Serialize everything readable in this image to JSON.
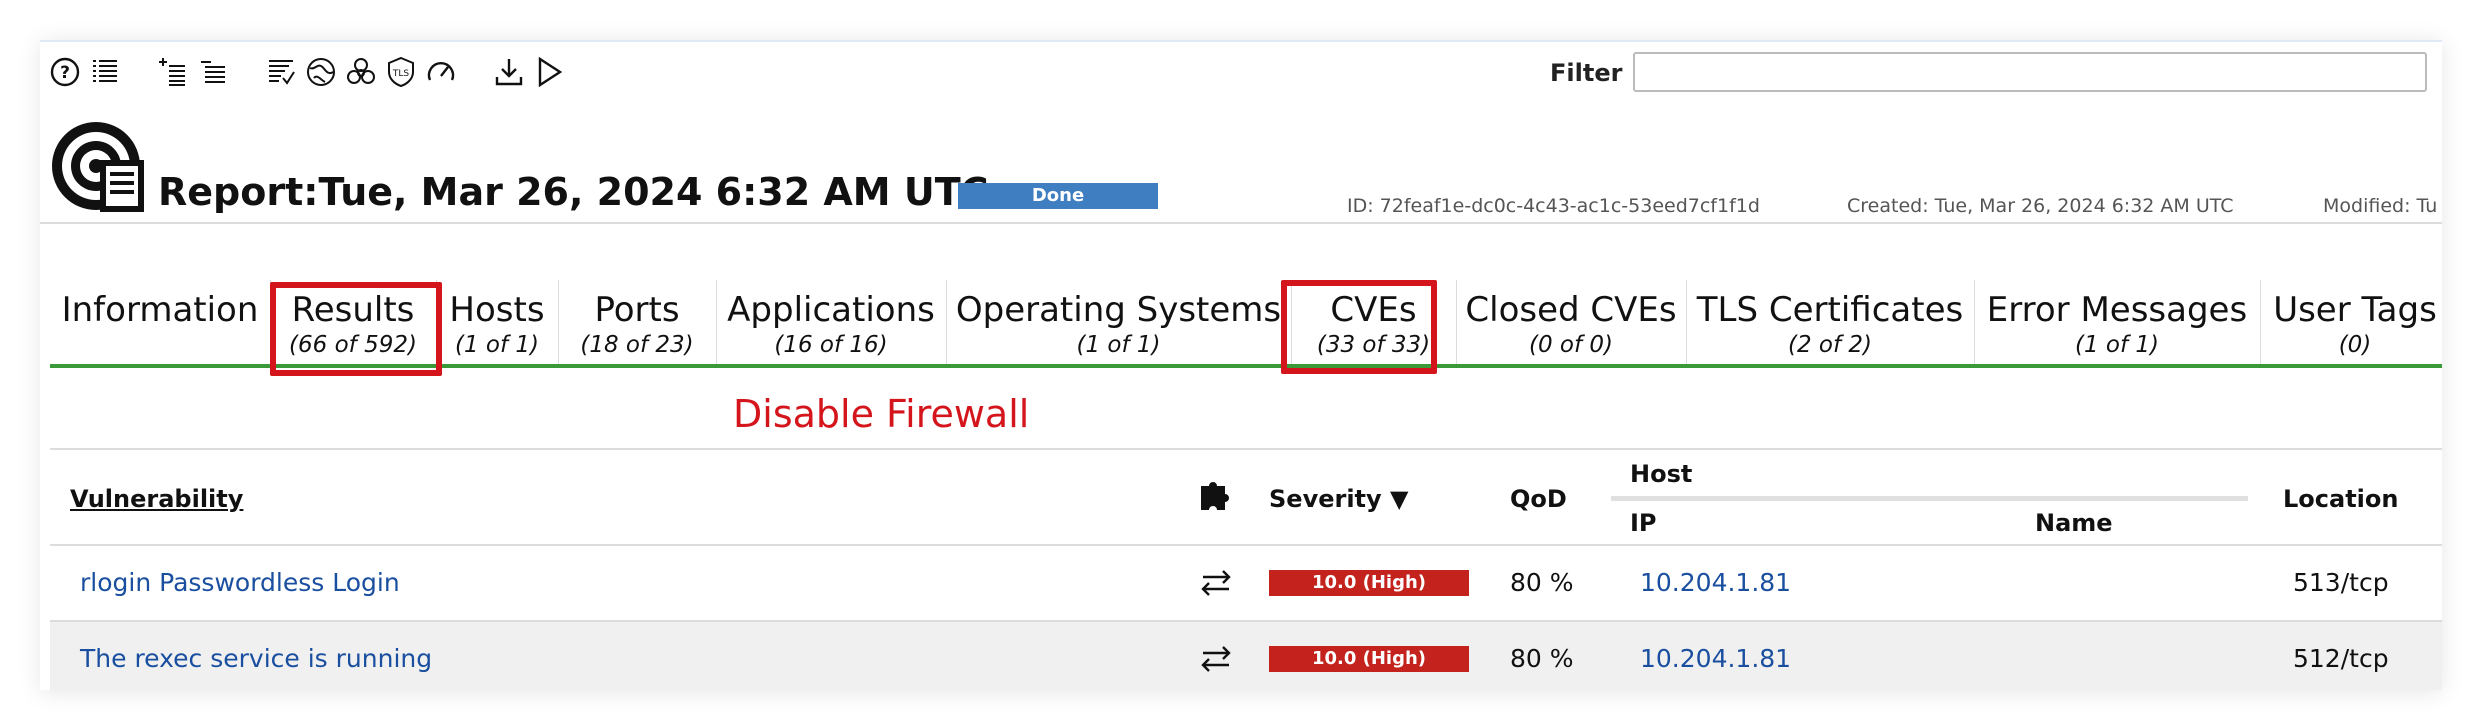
{
  "toolbar": {
    "icons": [
      "help-icon",
      "list-icon",
      "add-list-icon",
      "list-icon-2",
      "details-list-icon",
      "globe-icon",
      "biohazard-icon",
      "tls-shield-icon",
      "speedometer-icon",
      "download-icon",
      "play-icon"
    ]
  },
  "filter": {
    "label": "Filter",
    "value": "",
    "placeholder": ""
  },
  "report": {
    "title": "Report:Tue, Mar 26, 2024 6:32 AM UTC",
    "status": "Done",
    "status_color": "#3e7ec1",
    "id": "ID: 72feaf1e-dc0c-4c43-ac1c-53eed7cf1f1d",
    "created": "Created: Tue, Mar 26, 2024 6:32 AM UTC",
    "modified": "Modified: Tu"
  },
  "tabs": [
    {
      "label": "Information",
      "count": ""
    },
    {
      "label": "Results",
      "count": "(66 of 592)"
    },
    {
      "label": "Hosts",
      "count": "(1 of 1)"
    },
    {
      "label": "Ports",
      "count": "(18 of 23)"
    },
    {
      "label": "Applications",
      "count": "(16 of 16)"
    },
    {
      "label": "Operating Systems",
      "count": "(1 of 1)"
    },
    {
      "label": "CVEs",
      "count": "(33 of 33)"
    },
    {
      "label": "Closed CVEs",
      "count": "(0 of 0)"
    },
    {
      "label": "TLS Certificates",
      "count": "(2 of 2)"
    },
    {
      "label": "Error Messages",
      "count": "(1 of 1)"
    },
    {
      "label": "User Tags",
      "count": "(0)"
    }
  ],
  "annotation": "Disable Firewall",
  "annotation_color": "#d4161c",
  "table": {
    "headers": {
      "vulnerability": "Vulnerability",
      "severity": "Severity ▼",
      "qod": "QoD",
      "host": "Host",
      "ip": "IP",
      "name": "Name",
      "location": "Location"
    },
    "rows": [
      {
        "vulnerability": "rlogin Passwordless Login",
        "severity": "10.0 (High)",
        "qod": "80 %",
        "ip": "10.204.1.81",
        "name": "",
        "location": "513/tcp"
      },
      {
        "vulnerability": "The rexec service is running",
        "severity": "10.0 (High)",
        "qod": "80 %",
        "ip": "10.204.1.81",
        "name": "",
        "location": "512/tcp"
      }
    ]
  },
  "colors": {
    "severity_high": "#c4221c",
    "tab_underline": "#3a9a3a",
    "link": "#1a4fa0"
  }
}
